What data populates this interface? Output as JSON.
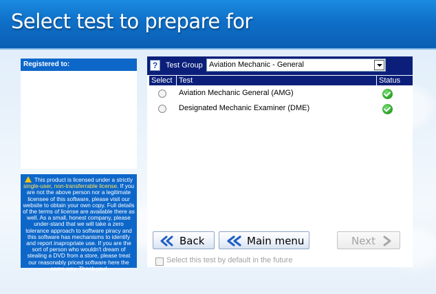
{
  "header": {
    "title": "Select test to prepare for"
  },
  "registration": {
    "title": "Registered to:"
  },
  "license": {
    "p1": "This product is licensed under a strictly ",
    "p1_hl": "single-user, non-transferrable license.",
    "p2": "  If you are not the above person nor a legitimate licensee of this software, please visit our website to obtain your own copy.  Full details of the terms of license are available there as well. As a small, honest company, please under-stand that we will take a zero tolerance approach to software piracy and this software has mechanisms to identify and report inapropriate use.  If you are the sort of person who wouldn't dream of stealing a DVD from a store, please treat our reasonably priced software here the same way.  Thank you!"
  },
  "test_group": {
    "help": "?",
    "label": "Test Group",
    "selected": "Aviation Mechanic - General"
  },
  "table": {
    "col_select": "Select",
    "col_test": "Test",
    "col_status": "Status",
    "rows": [
      {
        "name": "Aviation Mechanic General (AMG)"
      },
      {
        "name": "Designated Mechanic Examiner (DME)"
      }
    ]
  },
  "buttons": {
    "back": "Back",
    "main_menu": "Main menu",
    "next": "Next"
  },
  "default_option": {
    "label": "Select this test by default in the future"
  },
  "colors": {
    "header_blue": "#0f6fc8",
    "panel_blue": "#0d67c9",
    "navy": "#0b1f7a",
    "ok_green": "#2fa82a",
    "button_arrow": "#1f5fc4"
  }
}
